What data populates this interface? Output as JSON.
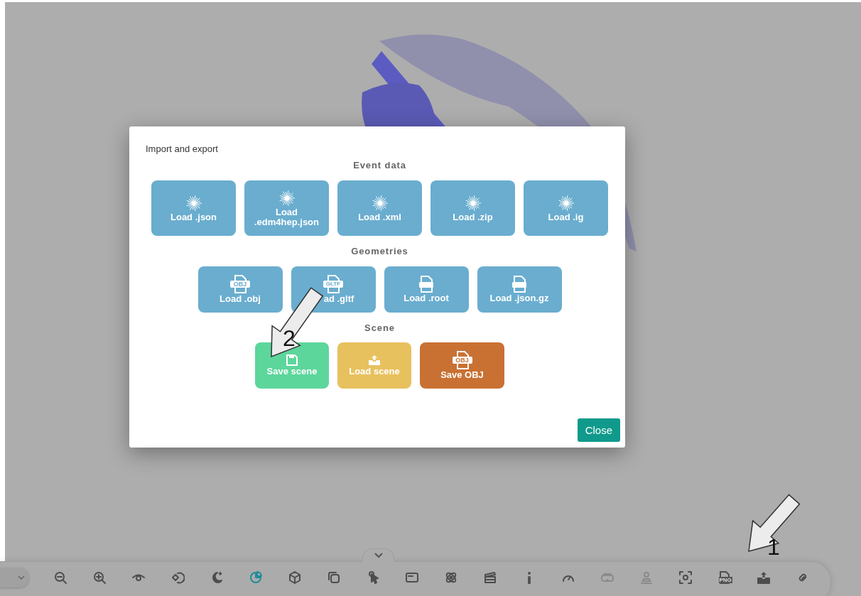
{
  "dialog": {
    "title": "Import and export",
    "sections": [
      {
        "heading": "Event data",
        "buttons": [
          {
            "label": "Load .json",
            "kind": "burst",
            "color": "#6aadcf"
          },
          {
            "label": "Load\n.edm4hep.json",
            "kind": "burst",
            "color": "#6aadcf"
          },
          {
            "label": "Load .xml",
            "kind": "burst",
            "color": "#6aadcf"
          },
          {
            "label": "Load .zip",
            "kind": "burst",
            "color": "#6aadcf"
          },
          {
            "label": "Load .ig",
            "kind": "burst",
            "color": "#6aadcf"
          }
        ]
      },
      {
        "heading": "Geometries",
        "buttons": [
          {
            "label": "Load .obj",
            "kind": "tagfile",
            "badge": "OBJ",
            "color": "#6aadcf"
          },
          {
            "label": "ad .gltf",
            "kind": "tagfile",
            "badge": "GLTF",
            "color": "#6aadcf"
          },
          {
            "label": "Load .root",
            "kind": "file",
            "color": "#6aadcf"
          },
          {
            "label": "Load .json.gz",
            "kind": "file",
            "color": "#6aadcf"
          }
        ]
      },
      {
        "heading": "Scene",
        "buttons": [
          {
            "label": "Save scene",
            "kind": "floppy",
            "color": "#5dd69c"
          },
          {
            "label": "Load scene",
            "kind": "tray",
            "color": "#e8c15f"
          },
          {
            "label": "Save OBJ",
            "kind": "tagfile",
            "badge": "OBJ",
            "color": "#c97133"
          }
        ]
      }
    ],
    "close": "Close"
  },
  "toolbar": {
    "items": [
      {
        "selected": false,
        "disabled": false
      },
      {
        "selected": false,
        "disabled": false
      },
      {
        "selected": false,
        "disabled": false
      },
      {
        "selected": false,
        "disabled": false
      },
      {
        "selected": false,
        "disabled": false
      },
      {
        "selected": true,
        "disabled": false
      },
      {
        "selected": false,
        "disabled": false
      },
      {
        "selected": false,
        "disabled": false
      },
      {
        "selected": false,
        "disabled": false
      },
      {
        "selected": false,
        "disabled": false
      },
      {
        "selected": false,
        "disabled": false
      },
      {
        "selected": false,
        "disabled": false
      },
      {
        "selected": false,
        "disabled": false
      },
      {
        "selected": false,
        "disabled": false
      },
      {
        "selected": false,
        "disabled": true
      },
      {
        "selected": false,
        "disabled": true
      },
      {
        "selected": false,
        "disabled": false
      },
      {
        "selected": false,
        "disabled": false,
        "badge": "PNG"
      },
      {
        "selected": false,
        "disabled": false
      },
      {
        "selected": false,
        "disabled": false
      }
    ]
  },
  "annotations": [
    {
      "label": "1"
    },
    {
      "label": "2"
    }
  ]
}
